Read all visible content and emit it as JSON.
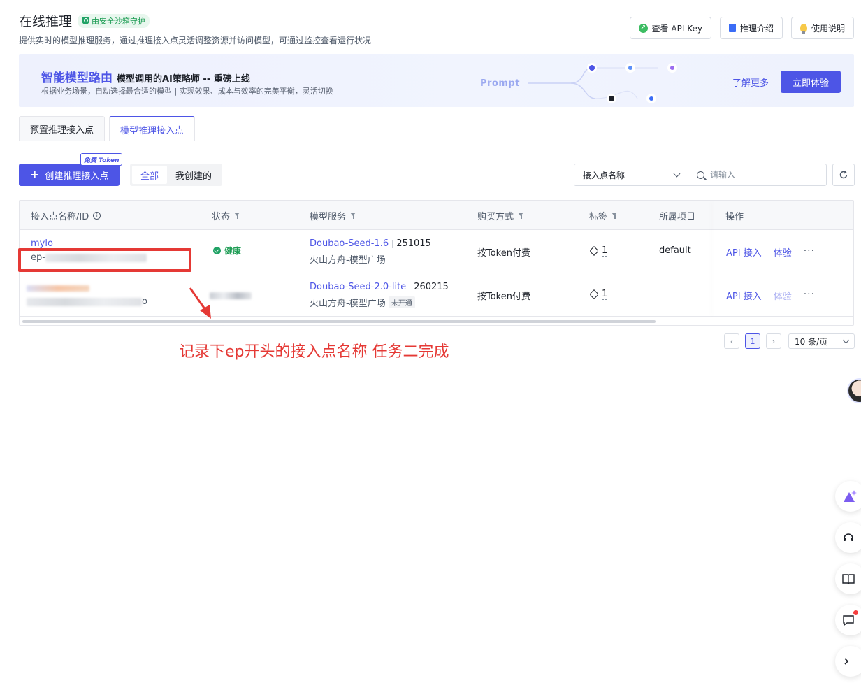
{
  "header": {
    "title": "在线推理",
    "sandbox_badge": "由安全沙箱守护",
    "description": "提供实时的模型推理服务，通过推理接入点灵活调整资源并访问模型，可通过监控查看运行状况"
  },
  "top_actions": {
    "api_key": "查看 API Key",
    "intro": "推理介绍",
    "usage": "使用说明"
  },
  "banner": {
    "brand": "智能模型路由",
    "subtitle": "模型调用的AI策略师 -- 重磅上线",
    "description": "根据业务场景，自动选择最合适的模型 | 实现效果、成本与效率的完美平衡，灵活切换",
    "prompt_label": "Prompt",
    "learn_more": "了解更多",
    "try_now": "立即体验"
  },
  "tabs": [
    {
      "label": "预置推理接入点",
      "active": false
    },
    {
      "label": "模型推理接入点",
      "active": true
    }
  ],
  "toolbar": {
    "create_label": "创建推理接入点",
    "free_token_badge": "免费 Token",
    "filter_all": "全部",
    "filter_mine": "我创建的",
    "search_field": "接入点名称",
    "search_placeholder": "请输入"
  },
  "table": {
    "columns": {
      "name": "接入点名称/ID",
      "status": "状态",
      "model": "模型服务",
      "purchase": "购买方式",
      "tags": "标签",
      "project": "所属项目",
      "actions": "操作"
    },
    "rows": [
      {
        "name": "mylo",
        "id_prefix": "ep-",
        "status": "健康",
        "model_name": "Doubao-Seed-1.6",
        "model_version": "251015",
        "model_source": "火山方舟-模型广场",
        "purchase": "按Token付费",
        "tag_count": "1",
        "project": "default",
        "action_api": "API 接入",
        "action_try": "体验"
      },
      {
        "name": "",
        "id_suffix": "o",
        "status": "",
        "model_name": "Doubao-Seed-2.0-lite",
        "model_version": "260215",
        "model_source": "火山方舟-模型广场",
        "model_badge": "未开通",
        "purchase": "按Token付费",
        "tag_count": "1",
        "project": "",
        "action_api": "API 接入",
        "action_try": "体验"
      }
    ]
  },
  "pagination": {
    "prev": "‹",
    "current": "1",
    "next": "›",
    "page_size": "10 条/页"
  },
  "annotation": {
    "text": "记录下ep开头的接入点名称 任务二完成"
  },
  "colors": {
    "primary": "#4d55e6",
    "success": "#1f9d55",
    "annotation": "#e53935"
  }
}
